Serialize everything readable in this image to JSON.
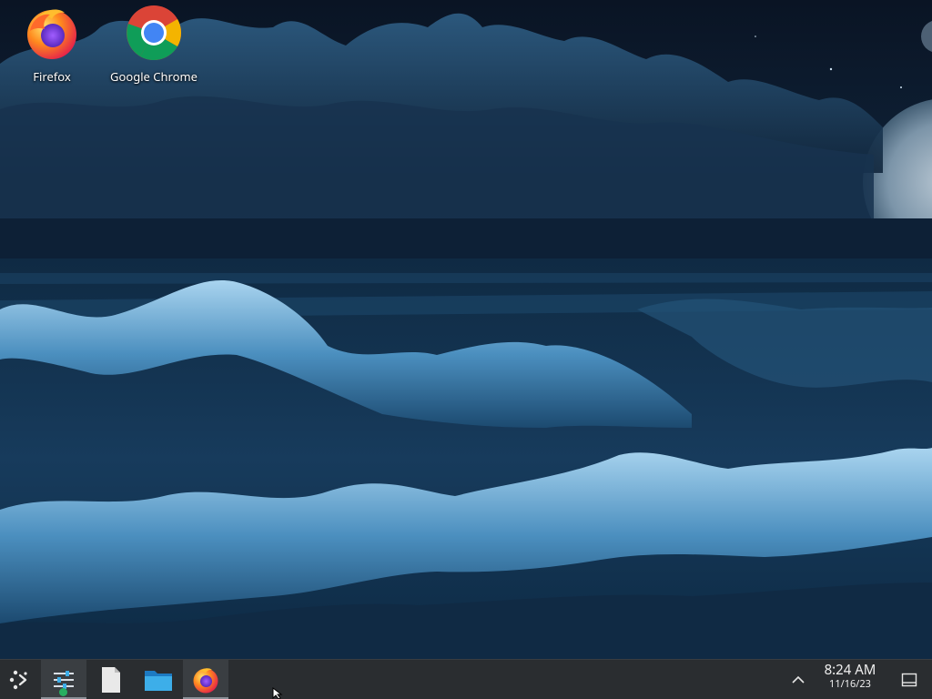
{
  "desktop": {
    "icons": [
      {
        "label": "Firefox",
        "icon": "firefox-icon"
      },
      {
        "label": "Google Chrome",
        "icon": "chrome-icon"
      }
    ]
  },
  "taskbar": {
    "launcher": {
      "icon": "app-launcher-icon"
    },
    "tasks": [
      {
        "icon": "system-settings-icon",
        "active": true
      },
      {
        "icon": "text-file-icon",
        "active": false
      },
      {
        "icon": "folder-icon",
        "active": false
      },
      {
        "icon": "firefox-icon",
        "active": true
      }
    ],
    "tray": {
      "expand_icon": "chevron-up-icon"
    },
    "clock": {
      "time": "8:24 AM",
      "date": "11/16/23"
    },
    "show_desktop": {
      "icon": "show-desktop-icon"
    }
  },
  "colors": {
    "taskbar_bg": "#2a2d30",
    "sky": "#0d1b2e",
    "wave_foam": "#8fc3e6"
  }
}
